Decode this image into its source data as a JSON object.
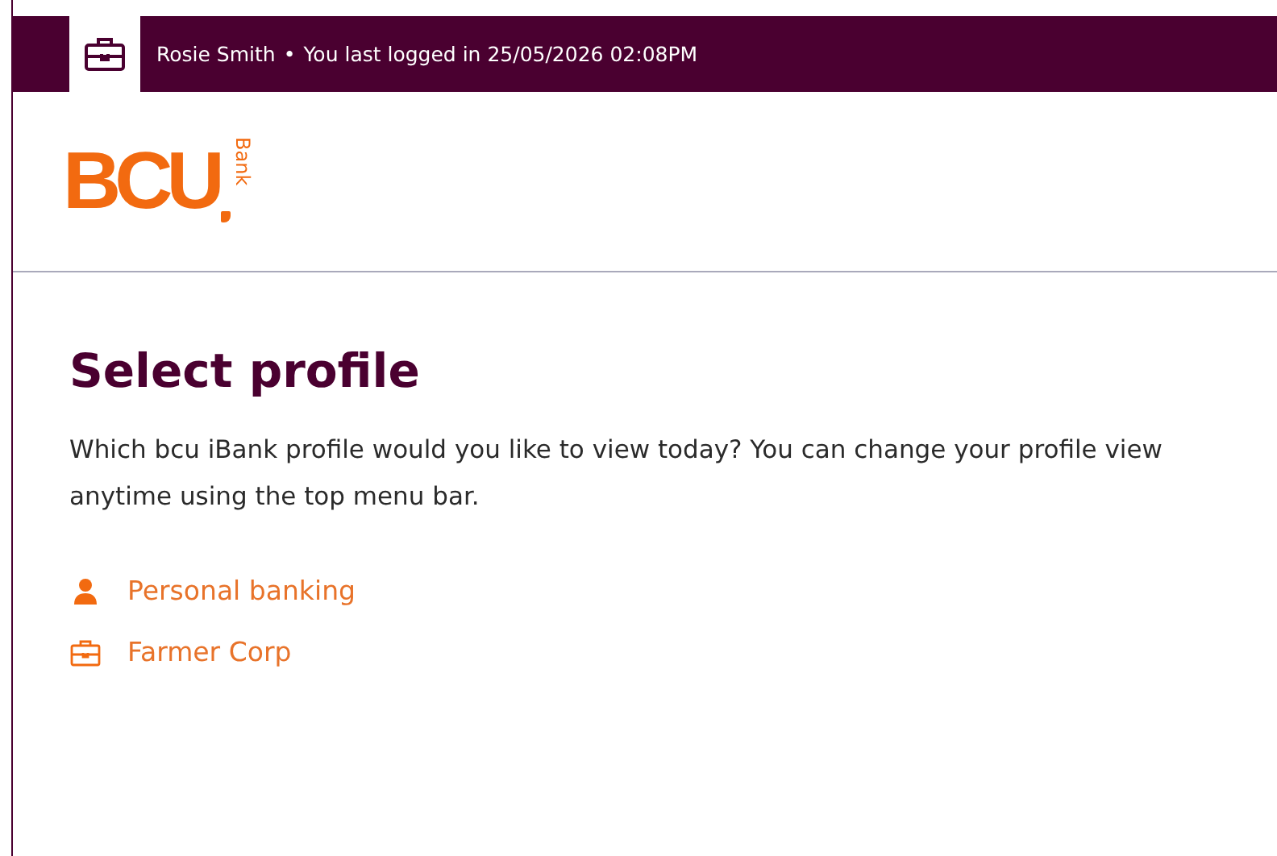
{
  "top_bar": {
    "user": "Rosie Smith",
    "separator": "•",
    "last_login": "You last logged in 25/05/2026 02:08PM"
  },
  "logo": {
    "main": "BCU",
    "side": "Bank"
  },
  "heading": "Select profile",
  "intro": "Which bcu iBank profile would you like to view today? You can change your profile view anytime using the top menu bar.",
  "profiles": [
    {
      "kind": "person",
      "label": "Personal banking"
    },
    {
      "kind": "business",
      "label": "Farmer Corp"
    }
  ]
}
